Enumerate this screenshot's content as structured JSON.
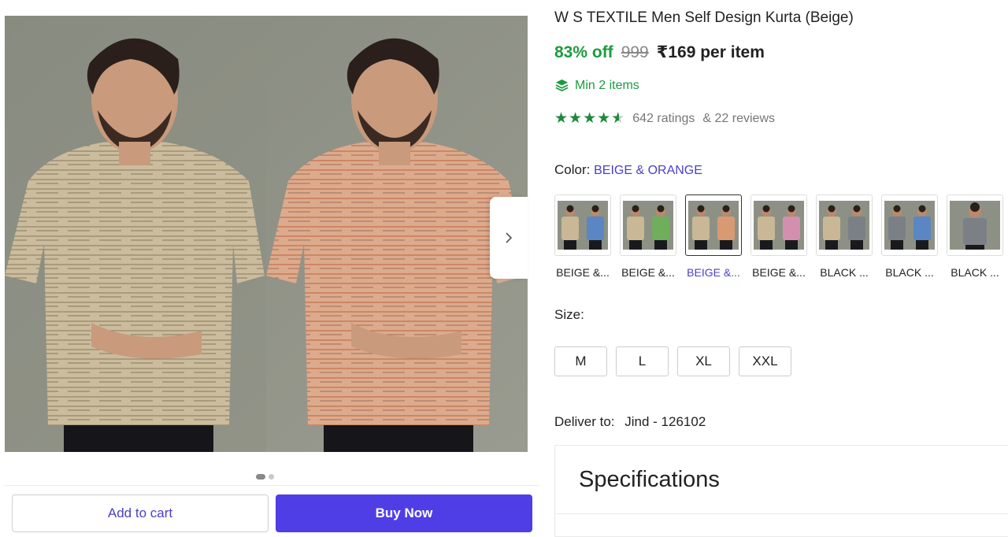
{
  "product": {
    "title": "W S TEXTILE Men Self Design Kurta (Beige)",
    "discount": "83% off",
    "mrp": "999",
    "price": "₹169 per item",
    "min_items": "Min 2 items",
    "ratings": "642 ratings",
    "reviews": "& 22 reviews",
    "rating_value": 4.5
  },
  "color": {
    "label": "Color:",
    "selected": "BEIGE & ORANGE",
    "options": [
      {
        "label": "BEIGE &...",
        "colors": [
          "#c9b796",
          "#5a86c4"
        ],
        "selected": false
      },
      {
        "label": "BEIGE &...",
        "colors": [
          "#c9b796",
          "#6fae5a"
        ],
        "selected": false
      },
      {
        "label": "BEIGE &...",
        "colors": [
          "#c9b796",
          "#d89a72"
        ],
        "selected": true
      },
      {
        "label": "BEIGE &...",
        "colors": [
          "#c9b796",
          "#d58fae"
        ],
        "selected": false
      },
      {
        "label": "BLACK ...",
        "colors": [
          "#c9b796",
          "#7b8086"
        ],
        "selected": false
      },
      {
        "label": "BLACK ...",
        "colors": [
          "#7b8086",
          "#5a86c4"
        ],
        "selected": false
      },
      {
        "label": "BLACK ...",
        "colors": [
          "#7b8086"
        ],
        "selected": false
      }
    ]
  },
  "size": {
    "label": "Size:",
    "options": [
      "M",
      "L",
      "XL",
      "XXL"
    ]
  },
  "delivery": {
    "label": "Deliver to:",
    "location": "Jind - 126102"
  },
  "specifications": {
    "title": "Specifications"
  },
  "actions": {
    "add_to_cart": "Add to cart",
    "buy_now": "Buy Now"
  },
  "gallery": {
    "slide_count": 2,
    "active_slide": 1,
    "kurta_colors": [
      "#c8b99a",
      "#d9a88a"
    ]
  },
  "colors": {
    "accent": "#4f3ee6",
    "link": "#4a3fc9",
    "success": "#1d9b3f"
  }
}
